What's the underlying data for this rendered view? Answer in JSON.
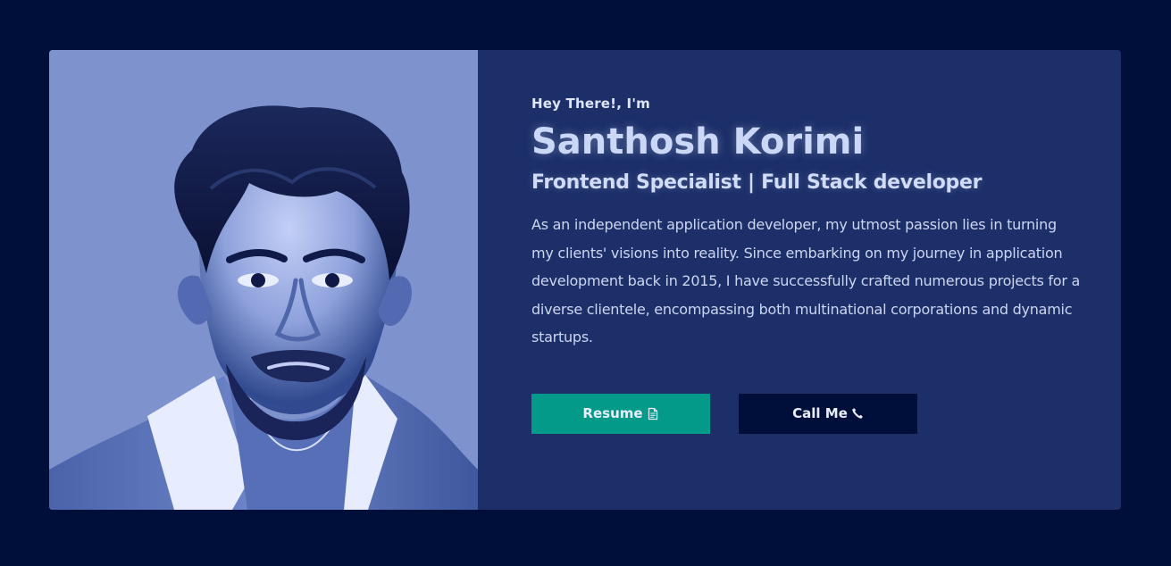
{
  "hero": {
    "greeting": "Hey There!, I'm",
    "name": "Santhosh Korimi",
    "role": "Frontend Specialist | Full Stack developer",
    "bio": "As an independent application developer, my utmost passion lies in turning my clients' visions into reality. Since embarking on my journey in application development back in 2015, I have successfully crafted numerous projects for a diverse clientele, encompassing both multinational corporations and dynamic startups.",
    "resume_label": "Resume",
    "resume_icon": "document-icon",
    "call_label": "Call Me",
    "call_icon": "phone-icon"
  },
  "colors": {
    "page_background": "#000e3a",
    "card_background": "#1c2f69",
    "portrait_background": "#7e92cd",
    "resume_button": "#049a8a",
    "call_button": "#000e3a"
  }
}
